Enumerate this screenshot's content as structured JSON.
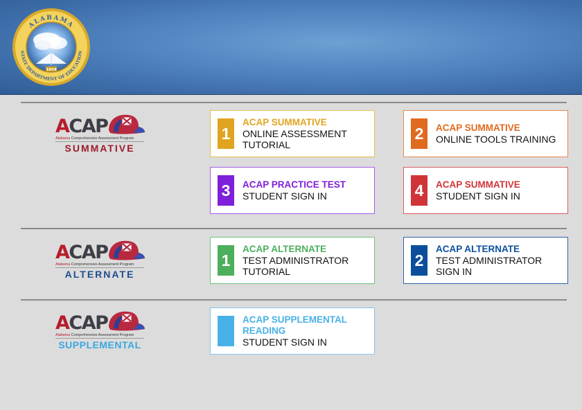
{
  "colors": {
    "header_blue": "#4f82bf",
    "summative_red": "#9c1b2a",
    "alternate_blue": "#1d4d8c",
    "supplemental_blue": "#3ba7e0",
    "yellow": "#e0a420",
    "orange": "#e06a20",
    "purple": "#7e1fd9",
    "red": "#d13438",
    "green": "#4caf5e",
    "navy": "#0b4f9c",
    "light_blue": "#48b1e8"
  },
  "header": {
    "seal": {
      "top_text": "ALABAMA",
      "bottom_text": "STATE DEPARTMENT OF EDUCATION",
      "year": "1854"
    }
  },
  "logo": {
    "word_first": "A",
    "word_rest": "CAP",
    "subtitle_state": "Alabama",
    "subtitle_rest": " Comprehensive Assessment Program"
  },
  "sections": {
    "summative": {
      "name": "SUMMATIVE",
      "cards": [
        {
          "number": "1",
          "title": "ACAP SUMMATIVE",
          "line2": "ONLINE ASSESSMENT",
          "line3": "TUTORIAL"
        },
        {
          "number": "2",
          "title": "ACAP SUMMATIVE",
          "line2": "ONLINE TOOLS TRAINING",
          "line3": ""
        },
        {
          "number": "3",
          "title": "ACAP PRACTICE TEST",
          "line2": "STUDENT SIGN IN",
          "line3": ""
        },
        {
          "number": "4",
          "title": "ACAP SUMMATIVE",
          "line2": "STUDENT SIGN IN",
          "line3": ""
        }
      ]
    },
    "alternate": {
      "name": "ALTERNATE",
      "cards": [
        {
          "number": "1",
          "title": "ACAP ALTERNATE",
          "line2": "TEST ADMINISTRATOR",
          "line3": "TUTORIAL"
        },
        {
          "number": "2",
          "title": "ACAP ALTERNATE",
          "line2": "TEST ADMINISTRATOR",
          "line3": "SIGN IN"
        }
      ]
    },
    "supplemental": {
      "name": "SUPPLEMENTAL",
      "cards": [
        {
          "number": "",
          "title": "ACAP SUPPLEMENTAL",
          "title2": "READING",
          "line2": "STUDENT SIGN IN"
        }
      ]
    }
  }
}
